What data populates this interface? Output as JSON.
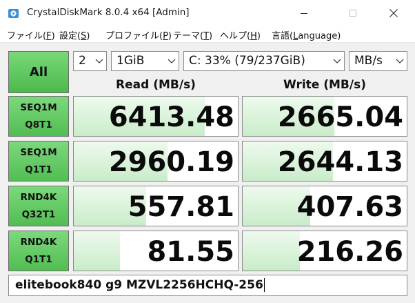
{
  "window": {
    "title": "CrystalDiskMark 8.0.4 x64 [Admin]",
    "icons": {
      "app": "disk-app-icon",
      "minimize": "minimize-icon",
      "maximize": "maximize-icon",
      "close": "close-icon"
    }
  },
  "menu": [
    {
      "text": "ファイル(",
      "key": "F",
      "tail": ")"
    },
    {
      "text": "設定(",
      "key": "S",
      "tail": ")"
    },
    {
      "text": "プロファイル(",
      "key": "P",
      "tail": ")"
    },
    {
      "text": "テーマ(",
      "key": "T",
      "tail": ")"
    },
    {
      "text": "ヘルプ(",
      "key": "H",
      "tail": ")"
    },
    {
      "text": "言語(",
      "key": "L",
      "tail": "anguage)"
    }
  ],
  "controls": {
    "all_label": "All",
    "count": "2",
    "size": "1GiB",
    "drive": "C: 33% (79/237GiB)",
    "unit": "MB/s"
  },
  "headers": {
    "read": "Read (MB/s)",
    "write": "Write (MB/s)"
  },
  "rows": [
    {
      "line1": "SEQ1M",
      "line2": "Q8T1",
      "read": "6413.48",
      "write": "2665.04",
      "read_fill": 0.8,
      "write_fill": 0.56
    },
    {
      "line1": "SEQ1M",
      "line2": "Q1T1",
      "read": "2960.19",
      "write": "2644.13",
      "read_fill": 0.57,
      "write_fill": 0.55
    },
    {
      "line1": "RND4K",
      "line2": "Q32T1",
      "read": "557.81",
      "write": "407.63",
      "read_fill": 0.44,
      "write_fill": 0.41
    },
    {
      "line1": "RND4K",
      "line2": "Q1T1",
      "read": "81.55",
      "write": "216.26",
      "read_fill": 0.28,
      "write_fill": 0.35
    }
  ],
  "comment": "elitebook840 g9 MZVL2256HCHQ-256",
  "colors": {
    "accent_green": "#4cb94c",
    "bar_fill": "#c9ecc9"
  }
}
